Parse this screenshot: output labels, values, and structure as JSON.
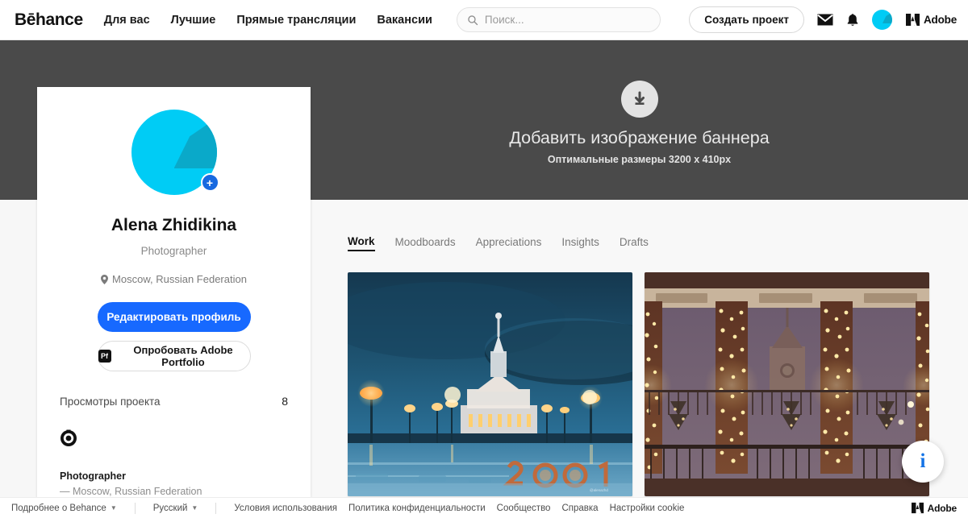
{
  "header": {
    "logo": "Bēhance",
    "nav": [
      {
        "label": "Для вас"
      },
      {
        "label": "Лучшие"
      },
      {
        "label": "Прямые трансляции"
      },
      {
        "label": "Вакансии"
      }
    ],
    "search": {
      "placeholder": "Поиск...",
      "value": "",
      "icon": "search-icon"
    },
    "create_button": "Создать проект",
    "icons": [
      "mail-icon",
      "bell-icon",
      "user-avatar",
      "adobe-logo"
    ],
    "adobe_label": "Adobe"
  },
  "banner": {
    "icon": "download-arrow-icon",
    "title": "Добавить изображение баннера",
    "subtitle": "Оптимальные размеры 3200 x 410px",
    "background_color": "#4a4a4a"
  },
  "profile": {
    "avatar": {
      "color": "#00ccf5",
      "accent_color": "#0aa9c9",
      "badge": "+",
      "badge_color": "#1769e0"
    },
    "name": "Alena Zhidikina",
    "role": "Photographer",
    "location": "Moscow, Russian Federation",
    "location_icon": "map-pin-icon",
    "edit_button": "Редактировать профиль",
    "portfolio_button": "Опробовать Adobe Portfolio",
    "portfolio_icon": "pf-icon",
    "stats": {
      "label": "Просмотры проекта",
      "value": "8"
    },
    "lens_icon": "camera-lens-icon",
    "about_title": "Photographer",
    "about_subtitle": "— Moscow, Russian Federation"
  },
  "tabs": [
    {
      "label": "Work",
      "active": true
    },
    {
      "label": "Moodboards",
      "active": false
    },
    {
      "label": "Appreciations",
      "active": false
    },
    {
      "label": "Insights",
      "active": false
    },
    {
      "label": "Drafts",
      "active": false
    }
  ],
  "projects": [
    {
      "name": "vdnkh-night-project",
      "alt": "Ночная ВДНХ с подсветкой и цифрами 2021"
    },
    {
      "name": "christmas-lights-project",
      "alt": "Колонны в гирляндах ночью"
    }
  ],
  "fab": {
    "icon": "info-icon",
    "label": "i",
    "color": "#1473e6"
  },
  "footer": {
    "about_dropdown": "Подробнее о Behance",
    "language_dropdown": "Русский",
    "links": [
      {
        "label": "Условия использования"
      },
      {
        "label": "Политика конфиденциальности"
      },
      {
        "label": "Сообщество"
      },
      {
        "label": "Справка"
      },
      {
        "label": "Настройки cookie"
      }
    ],
    "adobe_label": "Adobe"
  }
}
